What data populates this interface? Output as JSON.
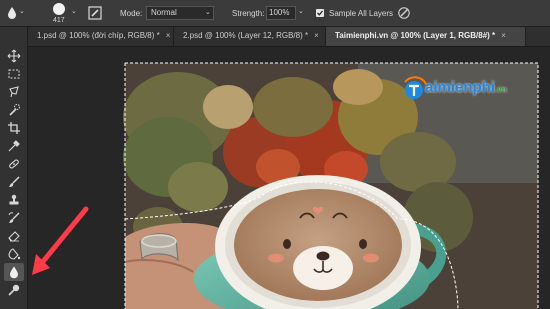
{
  "options_bar": {
    "brush_size": "417",
    "mode_label": "Mode:",
    "mode_value": "Normal",
    "strength_label": "Strength:",
    "strength_value": "100%",
    "sample_all_layers_label": "Sample All Layers",
    "sample_all_layers_checked": true
  },
  "tabs": [
    {
      "label": "1.psd @ 100% (đời chíp, RGB/8) *",
      "close": "×",
      "active": false
    },
    {
      "label": "2.psd @ 100% (Layer 12, RGB/8) *",
      "close": "×",
      "active": false
    },
    {
      "label": "Taimienphi.vn @ 100% (Layer 1, RGB/8#) *",
      "close": "×",
      "active": true
    }
  ],
  "toolbar": {
    "tools": [
      "move-tool",
      "marquee-tool",
      "lasso-tool",
      "quick-selection-tool",
      "crop-tool",
      "eyedropper-tool",
      "healing-brush-tool",
      "brush-tool",
      "clone-stamp-tool",
      "history-brush-tool",
      "eraser-tool",
      "gradient-tool",
      "blur-tool",
      "dodge-tool"
    ],
    "active_tool": "blur-tool"
  },
  "watermark": {
    "text": "aimienphi",
    "suffix": ".vn"
  },
  "colors": {
    "accent": "#ff3b4a",
    "active_tab": "#444444",
    "panel": "#3b3b3b"
  }
}
